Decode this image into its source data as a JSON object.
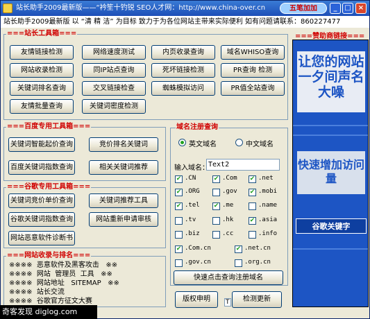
{
  "titlebar": {
    "title": "站长助手2009最新版——“衿笙十钓锐     SEO人才网：http://www.china-over.cn",
    "logo": "五笔加加",
    "min": "_",
    "max": "□",
    "close": "×"
  },
  "info": "站长助手2009最新版 以 “清 精 洁” 为目标 致力于为各位网站主带来实际便利 如有问题请联系：860227477",
  "station": {
    "title": "===站长工具箱===",
    "buttons": [
      "友情链接检测",
      "网络速度测试",
      "内页收录查询",
      "域名WHISO查询",
      "网站收录检测",
      "同IP站点查询",
      "死坏链接检测",
      "PR查询 检测",
      "关键词排名查询",
      "交叉链接检查",
      "蜘蛛模拟访问",
      "PR值全站查询",
      "友情批量查询",
      "关键词密度检测"
    ]
  },
  "baidu": {
    "title": "===百度专用工具箱===",
    "buttons": [
      "关键词智能起价查询",
      "竞价排名关键词",
      "百度关键词指数查询",
      "相关关键词推荐"
    ]
  },
  "google": {
    "title": "===谷歌专用工具箱===",
    "buttons": [
      "关键词竞价单价查询",
      "关键词推荐工具",
      "谷歌关键词指数查询",
      "网站重新申请审核",
      "网站恶意软件诊断书"
    ]
  },
  "links": {
    "title": "===网站收录与排名===",
    "text": "※※※※  恶意软件及黑客攻击   ※※\n※※※※  网站  管理员  工具   ※※\n※※※※  网站地址   SITEMAP   ※※\n※※※※  站长交流\n※※※※  谷歌官方征文大赛"
  },
  "domain": {
    "title": "域名注册查询",
    "radio_en": "英文域名",
    "radio_cn": "中文域名",
    "input_label": "输入域名：",
    "input_value": "Text2",
    "tlds": [
      {
        "name": ".CN",
        "checked": true
      },
      {
        "name": ".Com",
        "checked": true
      },
      {
        "name": ".net",
        "checked": true
      },
      {
        "name": ".ORG",
        "checked": true
      },
      {
        "name": ".gov",
        "checked": false
      },
      {
        "name": ".mobi",
        "checked": true
      },
      {
        "name": ".tel",
        "checked": true
      },
      {
        "name": ".me",
        "checked": true
      },
      {
        "name": ".name",
        "checked": false
      },
      {
        "name": ".tv",
        "checked": false
      },
      {
        "name": ".hk",
        "checked": false
      },
      {
        "name": ".asia",
        "checked": true
      },
      {
        "name": ".biz",
        "checked": false
      },
      {
        "name": ".cc",
        "checked": false
      },
      {
        "name": ".info",
        "checked": false
      },
      {
        "name": ".Com.cn",
        "checked": true
      },
      {
        "name": ".net.cn",
        "checked": true
      },
      {
        "name": ".gov.cn",
        "checked": false
      },
      {
        "name": ".org.cn",
        "checked": false
      }
    ],
    "check_mark": "✔",
    "query_button": "快速点击查询注册域名"
  },
  "bottom": {
    "copyright": "版权申明",
    "update": "检测更新",
    "small_label": "T"
  },
  "sponsor": {
    "title": "===赞助商链接===",
    "line1": "让您的网站一夕间声名大噪",
    "line2": "快速增加访问量",
    "line3": "谷歌关键字"
  },
  "watermark": "奇客发现 diglog.com",
  "colors": {
    "accent": "#d00000",
    "ad_bg": "#1d55c4"
  }
}
